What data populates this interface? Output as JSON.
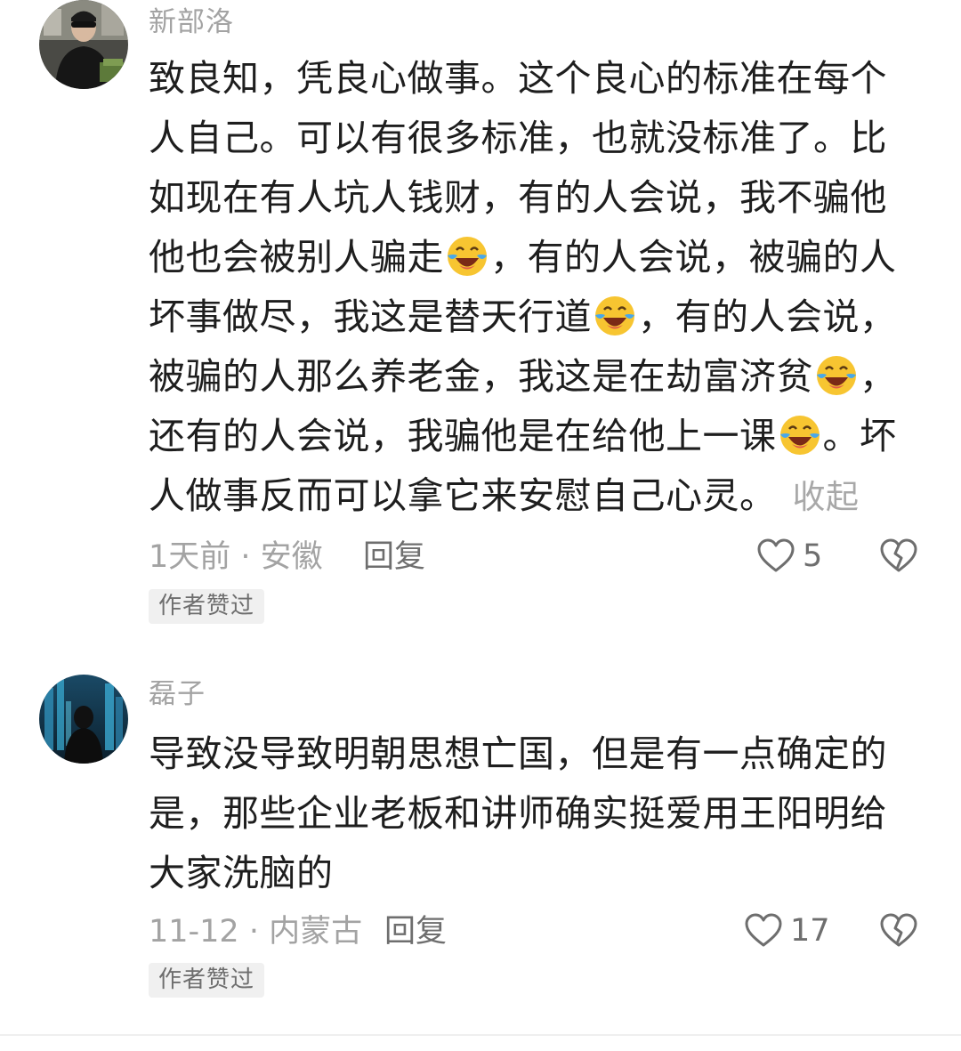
{
  "comments": [
    {
      "username": "新部洛",
      "lines": [
        [
          "致良知，凭良心做事。这个良心的标准在每个"
        ],
        [
          "人自己。可以有很多标准，也就没标准了。比"
        ],
        [
          "如现在有人坑人钱财，有的人会说，我不骗他"
        ],
        [
          "他也会被别人骗走",
          "，有的人会说，被骗的人"
        ],
        [
          "坏事做尽，我这是替天行道",
          "，有的人会说，"
        ],
        [
          "被骗的人那么养老金，我这是在劫富济贫",
          "，"
        ],
        [
          "还有的人会说，我骗他是在给他上一课",
          "。坏"
        ],
        [
          "人做事反而可以拿它来安慰自己心灵。"
        ]
      ],
      "collapse_label": "收起",
      "time_location": "1天前 · 安徽",
      "reply_label": "回复",
      "like_count": "5",
      "badge": "作者赞过",
      "emoji_icon": "laughing-crying-emoji"
    },
    {
      "username": "磊子",
      "lines": [
        [
          "导致没导致明朝思想亡国，但是有一点确定的"
        ],
        [
          "是，那些企业老板和讲师确实挺爱用王阳明给"
        ],
        [
          "大家洗脑的"
        ]
      ],
      "time_location": "11-12 · 内蒙古",
      "reply_label": "回复",
      "like_count": "17",
      "badge": "作者赞过"
    }
  ],
  "colors": {
    "meta_gray": "#a3a3a3",
    "text": "#1e1e1e",
    "badge_bg": "#f0f0f0"
  }
}
